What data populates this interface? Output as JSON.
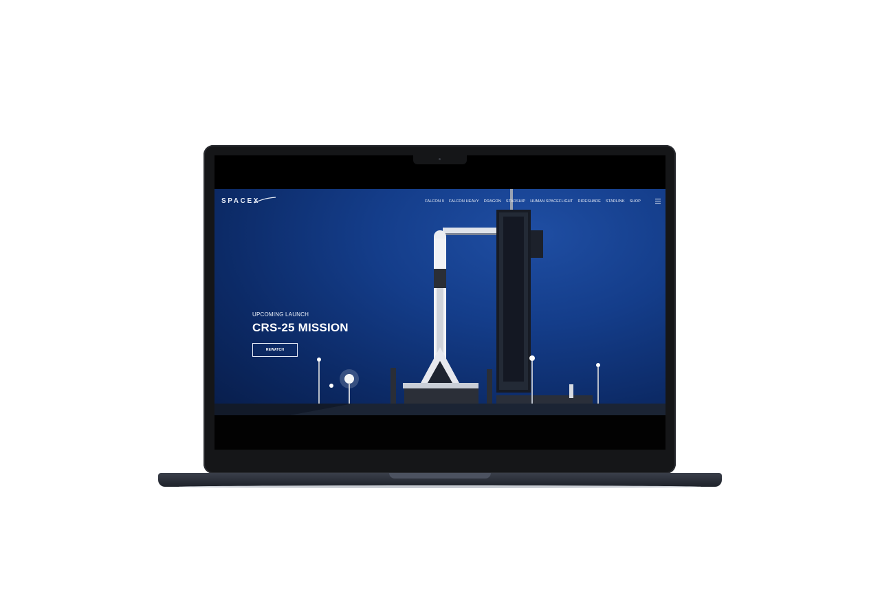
{
  "site": {
    "logo": "SPACEX",
    "nav": [
      "FALCON 9",
      "FALCON HEAVY",
      "DRAGON",
      "STARSHIP",
      "HUMAN SPACEFLIGHT",
      "RIDESHARE",
      "STARLINK",
      "SHOP"
    ],
    "menu_icon": "hamburger-menu-icon"
  },
  "hero": {
    "kicker": "UPCOMING LAUNCH",
    "headline": "CRS-25 MISSION",
    "cta": "REWATCH"
  },
  "colors": {
    "sky": "#143d8a",
    "text": "#ffffff",
    "device": "#151618"
  }
}
